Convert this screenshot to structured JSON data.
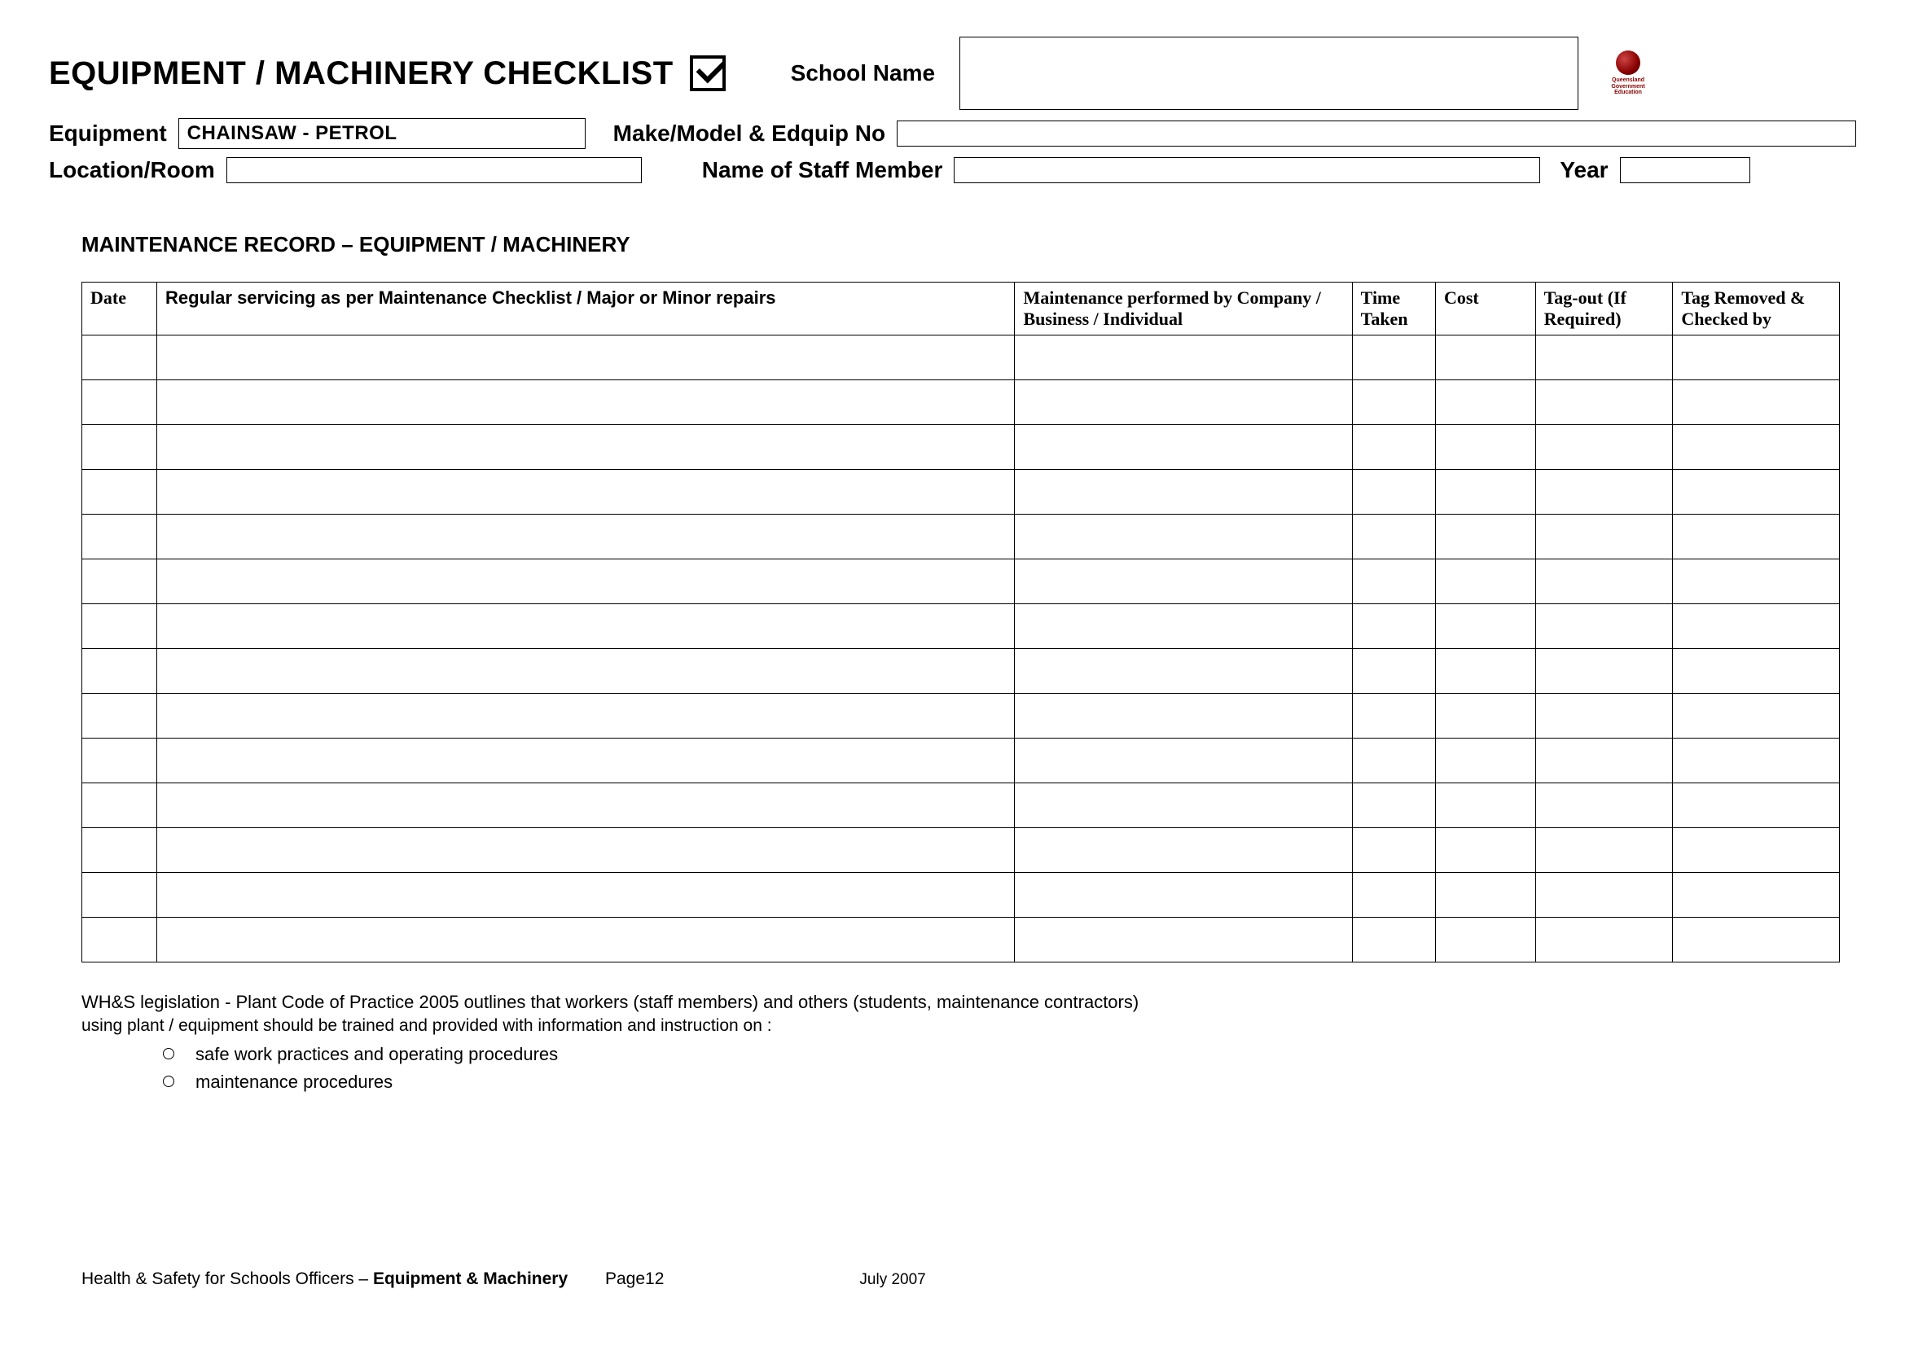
{
  "title": "EQUIPMENT / MACHINERY CHECKLIST",
  "school_name_label": "School Name",
  "logo_text": "Queensland Government Education",
  "equipment_label": "Equipment",
  "equipment_value": "CHAINSAW -  PETROL",
  "make_model_label": "Make/Model & Edquip No",
  "location_label": "Location/Room",
  "staff_label": "Name of Staff Member",
  "year_label": "Year",
  "section_title": "MAINTENANCE RECORD – EQUIPMENT / MACHINERY",
  "table_headers": {
    "date": "Date",
    "servicing": "Regular servicing as per Maintenance Checklist / Major or Minor repairs",
    "maintenance_by": "Maintenance performed by Company / Business / Individual",
    "time_taken": "Time Taken",
    "cost": "Cost",
    "tag_out": "Tag-out (If Required)",
    "tag_removed": "Tag Removed & Checked by"
  },
  "row_count": 14,
  "notes_line1": "WH&S legislation - Plant Code of Practice 2005 outlines that workers (staff members) and others (students, maintenance contractors)",
  "notes_line2": "using plant / equipment should be trained and provided with information and instruction on :",
  "bullets": [
    "safe work practices and operating procedures",
    "maintenance procedures"
  ],
  "footer_left_a": "Health & Safety for Schools Officers – ",
  "footer_left_b": "Equipment & Machinery",
  "footer_page": "Page12",
  "footer_date": "July 2007"
}
